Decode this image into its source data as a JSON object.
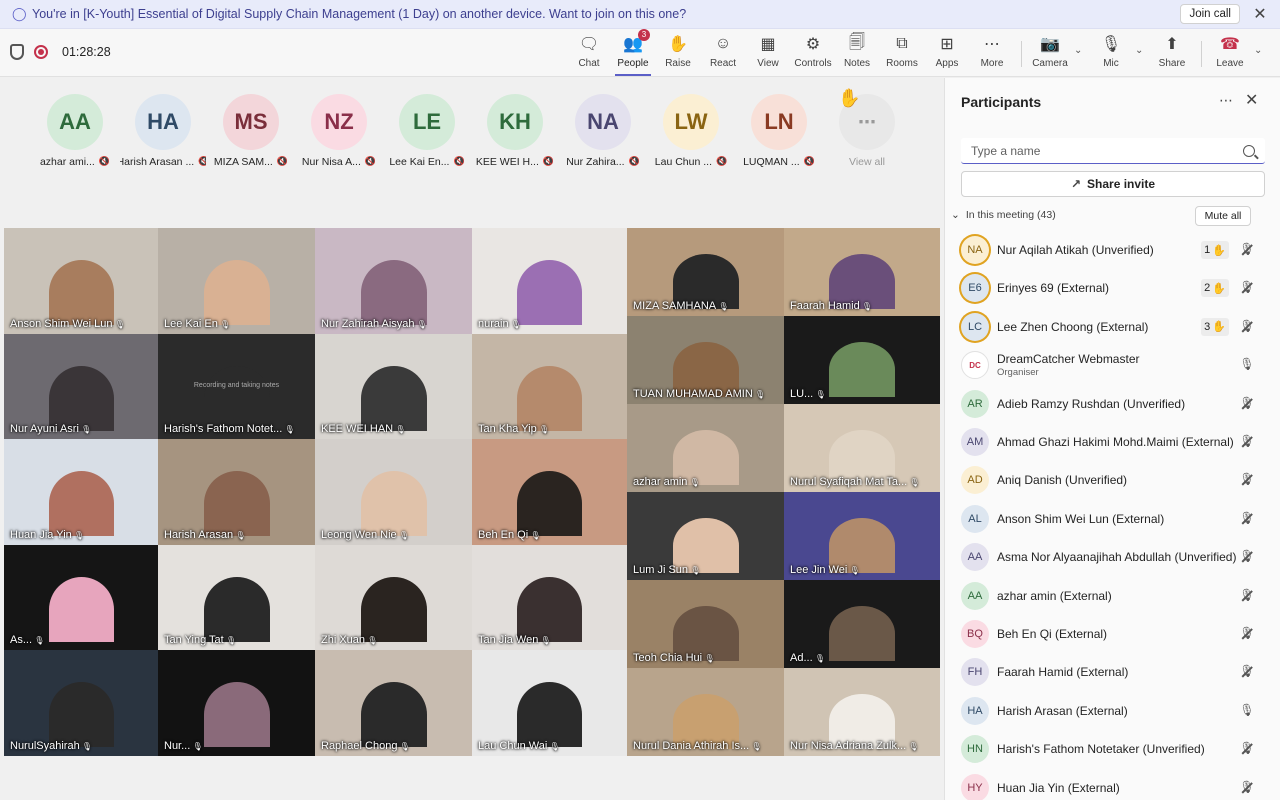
{
  "banner": {
    "text": "You're in [K-Youth] Essential of Digital Supply Chain Management (1 Day) on another device. Want to join on this one?",
    "join_label": "Join call"
  },
  "toolbar": {
    "timer": "01:28:28",
    "tools": [
      {
        "key": "chat",
        "label": "Chat",
        "icon": "chat-icon"
      },
      {
        "key": "people",
        "label": "People",
        "icon": "people-icon",
        "badge": "3",
        "active": true
      },
      {
        "key": "raise",
        "label": "Raise",
        "icon": "hand-icon"
      },
      {
        "key": "react",
        "label": "React",
        "icon": "smiley-icon"
      },
      {
        "key": "view",
        "label": "View",
        "icon": "grid-icon"
      },
      {
        "key": "controls",
        "label": "Controls",
        "icon": "controls-icon"
      },
      {
        "key": "notes",
        "label": "Notes",
        "icon": "notes-icon"
      },
      {
        "key": "rooms",
        "label": "Rooms",
        "icon": "rooms-icon"
      },
      {
        "key": "apps",
        "label": "Apps",
        "icon": "plus-icon"
      },
      {
        "key": "more",
        "label": "More",
        "icon": "more-icon"
      },
      {
        "key": "camera",
        "label": "Camera",
        "icon": "camera-off-icon"
      },
      {
        "key": "mic",
        "label": "Mic",
        "icon": "mic-icon"
      },
      {
        "key": "share",
        "label": "Share",
        "icon": "share-icon"
      },
      {
        "key": "leave",
        "label": "Leave",
        "icon": "phone-hangup-icon"
      }
    ]
  },
  "strip": {
    "participants": [
      {
        "initials": "AA",
        "name": "azhar ami...",
        "bg": "#d4ebd9",
        "fg": "#2e6b3c"
      },
      {
        "initials": "HA",
        "name": "Harish Arasan ...",
        "bg": "#dde6f0",
        "fg": "#2f4a66"
      },
      {
        "initials": "MS",
        "name": "MIZA SAM...",
        "bg": "#f3d6da",
        "fg": "#7a2e3a"
      },
      {
        "initials": "NZ",
        "name": "Nur Nisa A...",
        "bg": "#fadbe3",
        "fg": "#8a2f4a"
      },
      {
        "initials": "LE",
        "name": "Lee Kai En...",
        "bg": "#d4ebd9",
        "fg": "#2e6b3c"
      },
      {
        "initials": "KH",
        "name": "KEE WEI H...",
        "bg": "#d4ebd9",
        "fg": "#2e6b3c"
      },
      {
        "initials": "NA",
        "name": "Nur Zahira...",
        "bg": "#e3e1ee",
        "fg": "#4a4670"
      },
      {
        "initials": "LW",
        "name": "Lau Chun ...",
        "bg": "#fbefd3",
        "fg": "#8a6412"
      },
      {
        "initials": "LN",
        "name": "LUQMAN ...",
        "bg": "#f8e0d8",
        "fg": "#8a3a22"
      }
    ],
    "view_all_label": "View all"
  },
  "grid": {
    "notetaker_notice": "Recording and taking notes",
    "tiles": [
      {
        "name": "Anson Shim Wei Lun",
        "bg": "#c9c2b8",
        "skin": "#a87d5e"
      },
      {
        "name": "Lee Kai En",
        "bg": "#b8b0a6",
        "skin": "#d9b193"
      },
      {
        "name": "Nur Zahirah Aisyah",
        "bg": "#c9b8c4",
        "skin": "#8a6a80"
      },
      {
        "name": "nurain",
        "bg": "#e9e6e3",
        "skin": "#9b6fb3"
      },
      {
        "name": "MIZA SAMHANA",
        "bg": "#b69a7c",
        "skin": "#2a2a2a"
      },
      {
        "name": "Faarah Hamid",
        "bg": "#c2a98a",
        "skin": "#6a4f7a"
      },
      {
        "name": "Nur Ayuni Asri",
        "bg": "#6d6a70",
        "skin": "#3a3538"
      },
      {
        "name": "Harish's Fathom Notet...",
        "bg": "#2b2b2b",
        "skin": "#2b2b2b"
      },
      {
        "name": "KEE WEI HAN",
        "bg": "#d8d5d0",
        "skin": "#3a3a3a"
      },
      {
        "name": "Tan Kha Yip",
        "bg": "#c4b6a6",
        "skin": "#b58a6c"
      },
      {
        "name": "TUAN MUHAMAD AMIN",
        "bg": "#8c8270",
        "skin": "#8a6646"
      },
      {
        "name": "LU...",
        "bg": "#1a1a1a",
        "skin": "#6a8a5a"
      },
      {
        "name": "azhar amin",
        "bg": "#a89a88",
        "skin": "#d0b8a4"
      },
      {
        "name": "Nurul Syafiqah Mat Ta...",
        "bg": "#d6c8b6",
        "skin": "#e0d4c4"
      },
      {
        "name": "Huan Jia Yin",
        "bg": "#d8dee6",
        "skin": "#b07060"
      },
      {
        "name": "Harish Arasan",
        "bg": "#a69480",
        "skin": "#8a6450"
      },
      {
        "name": "Leong Wen Nie",
        "bg": "#d3cfcb",
        "skin": "#e0c2aa"
      },
      {
        "name": "Beh En Qi",
        "bg": "#c89a82",
        "skin": "#2a2420"
      },
      {
        "name": "Lum Ji Sun",
        "bg": "#3a3a3a",
        "skin": "#e0c0a8"
      },
      {
        "name": "Lee Jin Wei",
        "bg": "#4a4890",
        "skin": "#b08a6c"
      },
      {
        "name": "As...",
        "bg": "#151515",
        "skin": "#e7a5bd"
      },
      {
        "name": "Tan Ying Tat",
        "bg": "#e4e1dd",
        "skin": "#2a2a2a"
      },
      {
        "name": "Zhi Xuan",
        "bg": "#dedad6",
        "skin": "#2a2420"
      },
      {
        "name": "Tan Jia Wen",
        "bg": "#e2dedb",
        "skin": "#3a3030"
      },
      {
        "name": "Teoh Chia Hui",
        "bg": "#9a8266",
        "skin": "#6a5444"
      },
      {
        "name": "Ad...",
        "bg": "#1a1a1a",
        "skin": "#6a5848"
      },
      {
        "name": "NurulSyahirah",
        "bg": "#2a3440",
        "skin": "#2a2a2a"
      },
      {
        "name": "Nur...",
        "bg": "#121212",
        "skin": "#8a6a7a"
      },
      {
        "name": "Raphael Chong",
        "bg": "#c8bcb0",
        "skin": "#2a2a2a"
      },
      {
        "name": "Lau Chun Wai",
        "bg": "#e8e8e8",
        "skin": "#2a2a2a"
      },
      {
        "name": "Nurul Dania Athirah Is...",
        "bg": "#b8a48c",
        "skin": "#c8a070"
      },
      {
        "name": "Nur Nisa Adriana Zulk...",
        "bg": "#d0c4b4",
        "skin": "#f0ece6"
      }
    ]
  },
  "panel": {
    "title": "Participants",
    "search_placeholder": "Type a name",
    "share_invite_label": "Share invite",
    "section_label": "In this meeting (43)",
    "mute_all_label": "Mute all",
    "rows": [
      {
        "initials": "NA",
        "name": "Nur Aqilah Atikah (Unverified)",
        "raise": "1",
        "ring": true,
        "mic": "muted",
        "bg": "#fbefd3",
        "fg": "#8a6412"
      },
      {
        "initials": "E6",
        "name": "Erinyes 69 (External)",
        "raise": "2",
        "ring": true,
        "mic": "muted",
        "bg": "#dde6f0",
        "fg": "#2f4a66"
      },
      {
        "initials": "LC",
        "name": "Lee Zhen Choong (External)",
        "raise": "3",
        "ring": true,
        "mic": "muted",
        "bg": "#dde6f0",
        "fg": "#2f4a66"
      },
      {
        "initials": "DC",
        "name": "DreamCatcher Webmaster",
        "sub": "Organiser",
        "mic": "on",
        "bg": "#ffffff",
        "fg": "#c4314b"
      },
      {
        "initials": "AR",
        "name": "Adieb Ramzy Rushdan (Unverified)",
        "mic": "muted",
        "bg": "#d4ebd9",
        "fg": "#2e6b3c"
      },
      {
        "initials": "AM",
        "name": "Ahmad Ghazi Hakimi Mohd.Maimi (External)",
        "mic": "muted",
        "bg": "#e3e1ee",
        "fg": "#4a4670"
      },
      {
        "initials": "AD",
        "name": "Aniq Danish (Unverified)",
        "mic": "muted",
        "bg": "#fbefd3",
        "fg": "#8a6412"
      },
      {
        "initials": "AL",
        "name": "Anson Shim Wei Lun (External)",
        "mic": "muted",
        "bg": "#dde6f0",
        "fg": "#2f4a66"
      },
      {
        "initials": "AA",
        "name": "Asma Nor Alyaanajihah Abdullah (Unverified)",
        "mic": "muted",
        "bg": "#e3e1ee",
        "fg": "#4a4670"
      },
      {
        "initials": "AA",
        "name": "azhar amin (External)",
        "mic": "muted",
        "bg": "#d4ebd9",
        "fg": "#2e6b3c"
      },
      {
        "initials": "BQ",
        "name": "Beh En Qi (External)",
        "mic": "muted",
        "bg": "#fadbe3",
        "fg": "#8a2f4a"
      },
      {
        "initials": "FH",
        "name": "Faarah Hamid (External)",
        "mic": "muted",
        "bg": "#e3e1ee",
        "fg": "#4a4670"
      },
      {
        "initials": "HA",
        "name": "Harish Arasan (External)",
        "mic": "on",
        "bg": "#dde6f0",
        "fg": "#2f4a66"
      },
      {
        "initials": "HN",
        "name": "Harish's Fathom Notetaker (Unverified)",
        "mic": "muted",
        "bg": "#d4ebd9",
        "fg": "#2e6b3c"
      },
      {
        "initials": "HY",
        "name": "Huan Jia Yin (External)",
        "mic": "muted",
        "bg": "#fadbe3",
        "fg": "#8a2f4a"
      }
    ]
  }
}
